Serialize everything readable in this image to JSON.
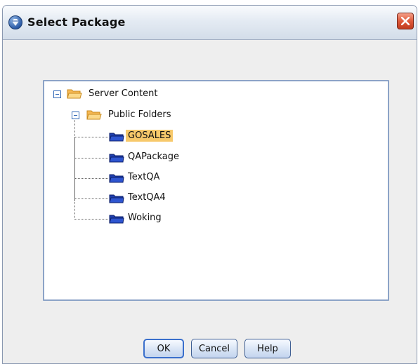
{
  "window": {
    "title": "Select Package",
    "app_icon": "cognos-icon",
    "close_icon": "close-icon"
  },
  "tree": {
    "root": {
      "label": "Server Content",
      "icon": "folder-open-icon"
    },
    "public_folders": {
      "label": "Public Folders",
      "icon": "folder-open-icon"
    },
    "packages": [
      {
        "label": "GOSALES",
        "icon": "package-icon",
        "selected": true
      },
      {
        "label": "QAPackage",
        "icon": "package-icon",
        "selected": false
      },
      {
        "label": "TextQA",
        "icon": "package-icon",
        "selected": false
      },
      {
        "label": "TextQA4",
        "icon": "package-icon",
        "selected": false
      },
      {
        "label": "Woking",
        "icon": "package-icon",
        "selected": false
      }
    ]
  },
  "buttons": {
    "ok": "OK",
    "cancel": "Cancel",
    "help": "Help"
  },
  "colors": {
    "selection": "#f7c96b",
    "tree_border": "#8ca3c7",
    "close_button": "#de5a3b",
    "package_blue": "#1f3fae"
  }
}
